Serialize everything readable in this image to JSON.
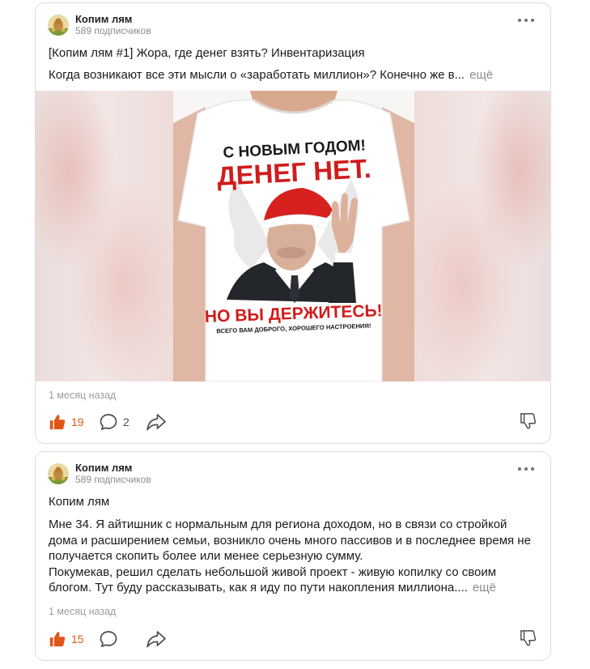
{
  "posts": [
    {
      "channel_name": "Копим лям",
      "subscribers": "589 подписчиков",
      "title": "[Копим лям #1] Жора, где денег взять? Инвентаризация",
      "excerpt": "Когда возникают все эти мысли о «заработать миллион»? Конечно же в...",
      "more_label": "ещё",
      "image_text": {
        "line1": "С НОВЫМ ГОДОМ!",
        "line2": "ДЕНЕГ НЕТ.",
        "line3": "НО ВЫ ДЕРЖИТЕСЬ!",
        "line4": "ВСЕГО ВАМ ДОБРОГО, ХОРОШЕГО НАСТРОЕНИЯ!"
      },
      "date": "1 месяц назад",
      "likes": "19",
      "comments": "2"
    },
    {
      "channel_name": "Копим лям",
      "subscribers": "589 подписчиков",
      "title": "Копим лям",
      "paragraph1": "Мне 34. Я айтишник с нормальным для региона доходом, но в связи со стройкой дома и расширением семьи, возникло очень много пассивов и в последнее время не получается скопить более или менее серьезную сумму.",
      "paragraph2": "Покумекав, решил сделать небольшой живой проект - живую копилку со своим блогом. Тут буду рассказывать, как я иду по пути накопления миллиона....",
      "more_label": "ещё",
      "date": "1 месяц назад",
      "likes": "15"
    }
  ],
  "colors": {
    "like_accent": "#e0561a",
    "muted_text": "#8a8c91",
    "card_border": "#dcdde1"
  },
  "icons": [
    "kebab-menu-icon",
    "thumbs-up-icon",
    "comment-bubble-icon",
    "share-arrow-icon",
    "thumbs-down-icon"
  ]
}
